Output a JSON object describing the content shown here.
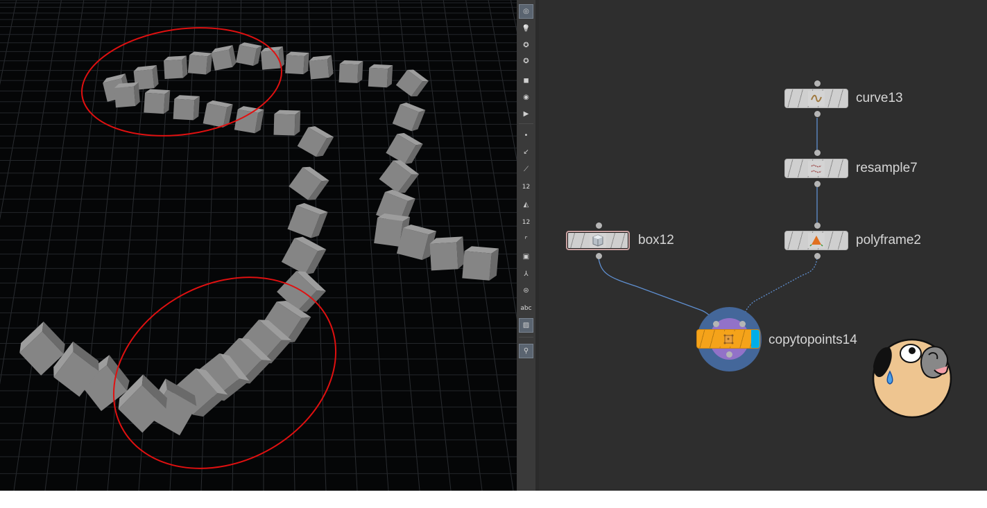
{
  "toolbar": {
    "items": [
      {
        "icon": "display-options-icon"
      },
      {
        "icon": "light-bulb-icon"
      },
      {
        "icon": "headlight-icon"
      },
      {
        "icon": "ambient-light-icon"
      },
      {
        "icon": "shading-mode-icon"
      },
      {
        "icon": "visibility-eye-icon"
      },
      {
        "icon": "camera-icon"
      },
      {
        "icon": "point-display-icon"
      },
      {
        "icon": "point-normal-icon"
      },
      {
        "icon": "vertex-normal-icon"
      },
      {
        "icon": "point-numbers-icon",
        "label": "12"
      },
      {
        "icon": "primitive-normal-icon"
      },
      {
        "icon": "primitive-numbers-icon",
        "label": "12"
      },
      {
        "icon": "hull-icon"
      },
      {
        "icon": "uv-points-icon"
      },
      {
        "icon": "transform-handle-icon"
      },
      {
        "icon": "profile-icon"
      },
      {
        "icon": "attribute-text-icon",
        "label": "abc"
      },
      {
        "icon": "background-image-icon"
      },
      {
        "icon": "pin-location-icon"
      }
    ]
  },
  "network": {
    "nodes": {
      "curve": {
        "label": "curve13",
        "icon": "curve-icon"
      },
      "resample": {
        "label": "resample7",
        "icon": "resample-icon"
      },
      "polyframe": {
        "label": "polyframe2",
        "icon": "polyframe-icon"
      },
      "box": {
        "label": "box12",
        "icon": "box-icon"
      },
      "copytopoints": {
        "label": "copytopoints14",
        "icon": "copy-to-points-icon"
      }
    },
    "colors": {
      "wire": "#5f8fd0",
      "copy_node": "#f5a31a",
      "display_flag": "#00aee8",
      "selection_ring": "#4a6fa8",
      "selection_inner": "#9272c8",
      "annotation_ellipse": "#e01010"
    }
  }
}
